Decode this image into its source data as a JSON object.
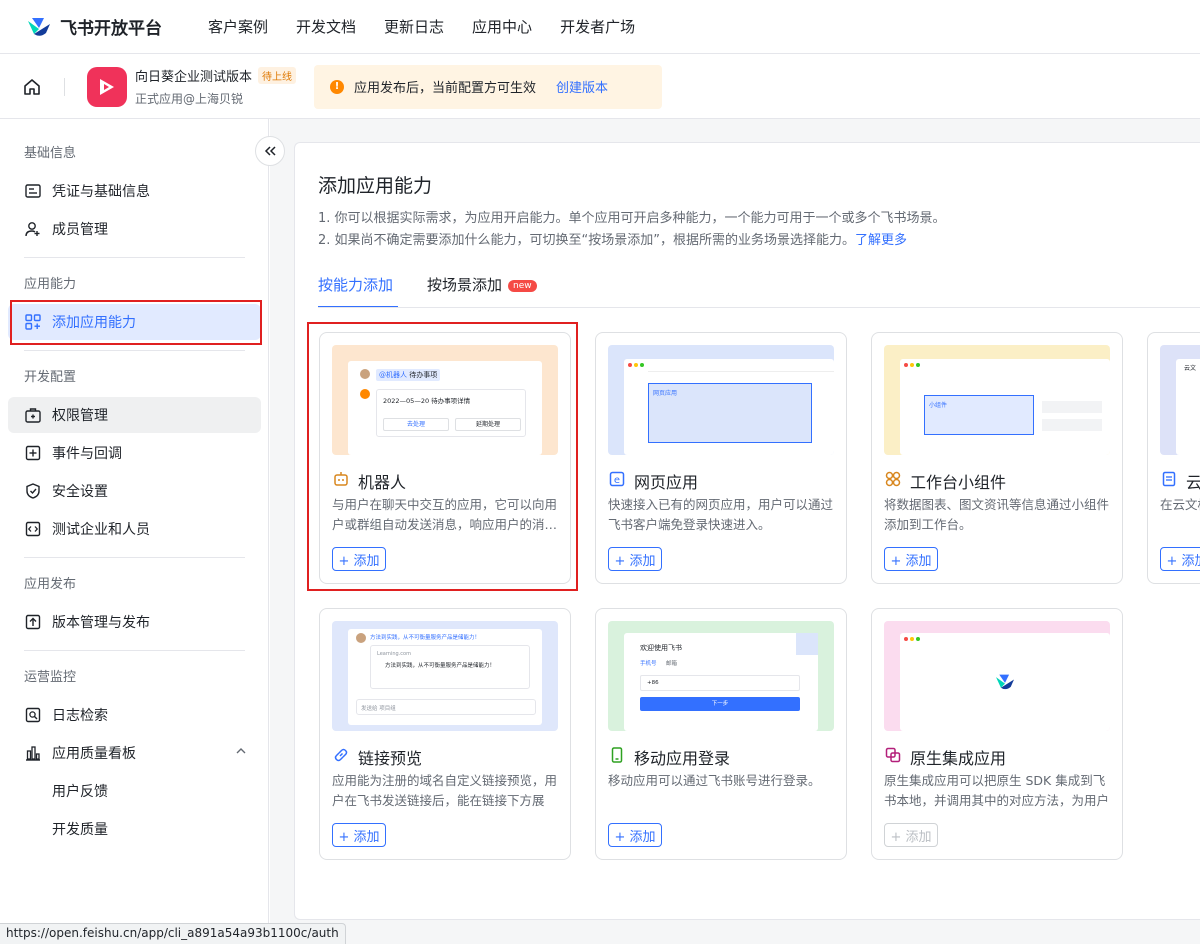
{
  "brand": {
    "name": "飞书开放平台"
  },
  "topnav": {
    "items": [
      "客户案例",
      "开发文档",
      "更新日志",
      "应用中心",
      "开发者广场"
    ]
  },
  "app": {
    "name": "向日葵企业测试版本",
    "badge": "待上线",
    "subtitle": "正式应用@上海贝锐"
  },
  "notice": {
    "text": "应用发布后，当前配置方可生效",
    "link": "创建版本"
  },
  "sidebar": {
    "groups": {
      "basic": "基础信息",
      "ability": "应用能力",
      "dev": "开发配置",
      "release": "应用发布",
      "ops": "运营监控"
    },
    "items": {
      "credentials": "凭证与基础信息",
      "members": "成员管理",
      "add_ability": "添加应用能力",
      "permissions": "权限管理",
      "events": "事件与回调",
      "security": "安全设置",
      "test_org": "测试企业和人员",
      "versions": "版本管理与发布",
      "logs": "日志检索",
      "quality": "应用质量看板",
      "feedback": "用户反馈",
      "dev_quality": "开发质量"
    }
  },
  "main": {
    "title": "添加应用能力",
    "desc1": "1. 你可以根据实际需求，为应用开启能力。单个应用可开启多种能力，一个能力可用于一个或多个飞书场景。",
    "desc2": "2. 如果尚不确定需要添加什么能力，可切换至“按场景添加”，根据所需的业务场景选择能力。",
    "learn_more": "了解更多",
    "tabs": {
      "by_ability": "按能力添加",
      "by_scene": "按场景添加",
      "new_badge": "new"
    }
  },
  "cards": {
    "bot": {
      "title": "机器人",
      "desc": "与用户在聊天中交互的应用，它可以向用户或群组自动发送消息，响应用户的消…",
      "add": "+ 添加",
      "thumb": {
        "tag": "@机器人",
        "tag_text": "待办事项",
        "date": "2022—05—20 待办事项详情",
        "btn1": "去处理",
        "btn2": "延期处理"
      }
    },
    "web": {
      "title": "网页应用",
      "desc": "快速接入已有的网页应用，用户可以通过飞书客户端免登录快速进入。",
      "add": "+ 添加",
      "thumb": {
        "label": "网页应用"
      }
    },
    "widget": {
      "title": "工作台小组件",
      "desc": "将数据图表、图文资讯等信息通过小组件添加到工作台。",
      "add": "+ 添加",
      "thumb": {
        "label": "小组件"
      }
    },
    "cloud": {
      "title": "云",
      "desc": "在云文档",
      "add": "+ 添加",
      "thumb": {
        "label": "云文"
      }
    },
    "link": {
      "title": "链接预览",
      "desc": "应用能为注册的域名自定义链接预览，用户在飞书发送链接后，能在链接下方展示…",
      "add": "+ 添加",
      "thumb": {
        "msg": "方法到实践，从不可衡量服务产品是储能力！",
        "site": "Learning.com",
        "text": "方法到实践，从不可衡量服务产品是储能力！",
        "input": "发送给 项目组"
      }
    },
    "mobile": {
      "title": "移动应用登录",
      "desc": "移动应用可以通过飞书账号进行登录。",
      "add": "+ 添加",
      "thumb": {
        "welcome": "欢迎使用飞书",
        "tab1": "手机号",
        "tab2": "邮箱",
        "code": "+86",
        "next": "下一步"
      }
    },
    "native": {
      "title": "原生集成应用",
      "desc": "原生集成应用可以把原生 SDK 集成到飞书本地，并调用其中的对应方法，为用户提…",
      "add": "+ 添加"
    }
  },
  "statusbar": {
    "url": "https://open.feishu.cn/app/cli_a891a54a93b1100c/auth"
  },
  "colors": {
    "accent": "#3370ff",
    "highlight": "#e02020"
  }
}
